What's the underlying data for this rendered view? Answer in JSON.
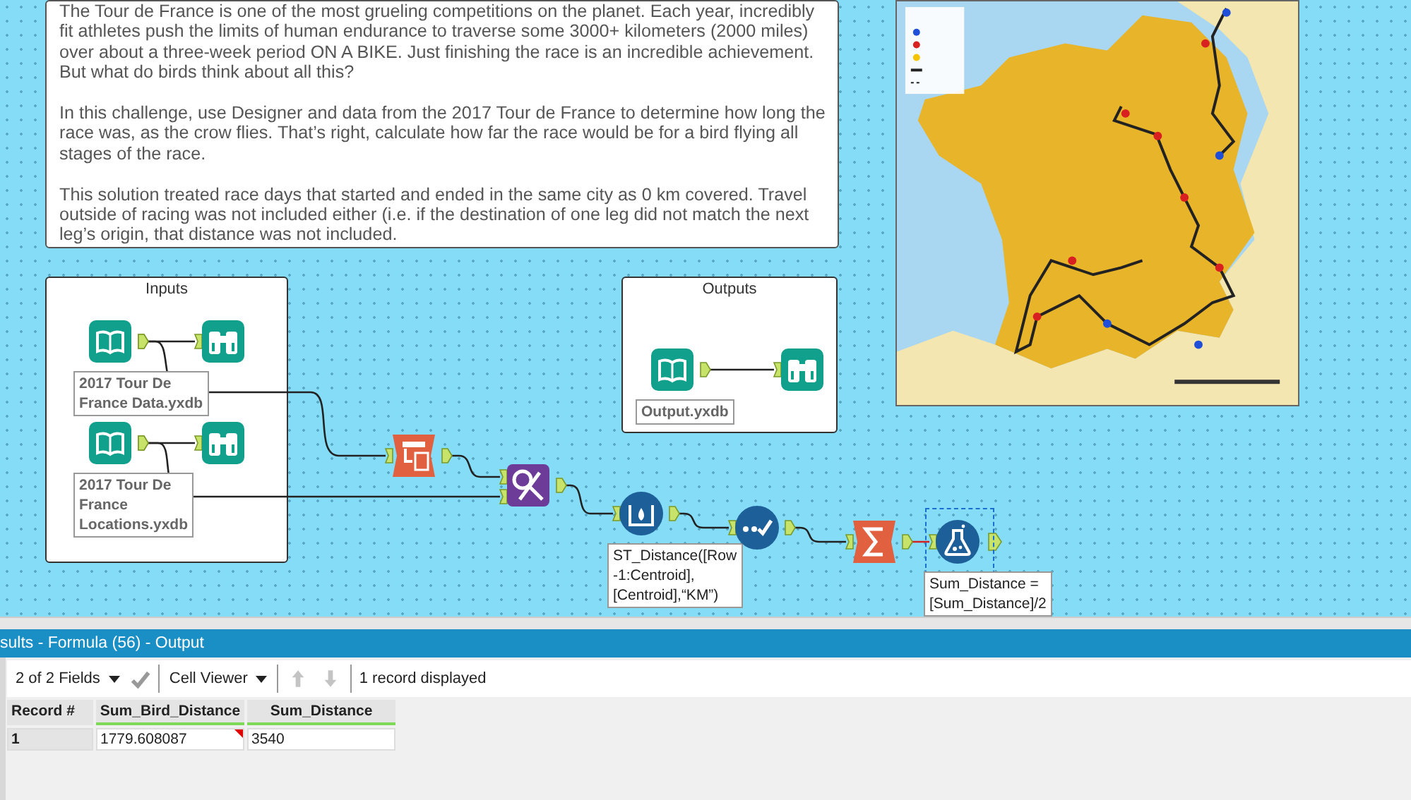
{
  "comment": {
    "paragraphs": [
      "The Tour de France is one of the most grueling competitions on the planet. Each year, incredibly fit athletes push the limits of human endurance to traverse some 3000+ kilometers (2000 miles) over about a three-week period ON A BIKE. Just finishing the race is an incredible achievement. But what do birds think about all this?",
      "In this challenge, use Designer and data from the 2017 Tour de France to determine how long the race was, as the crow flies. That’s right, calculate how far the race would be for a bird flying all stages of the race.",
      "This solution treated race days that started and ended in the same city as 0 km covered. Travel outside of racing was not included either (i.e. if the destination of one leg did not match the next leg’s origin, that distance was not included."
    ]
  },
  "containers": [
    {
      "title": "Inputs"
    },
    {
      "title": "Outputs"
    }
  ],
  "tools": [
    {
      "kind": "input",
      "selected": false,
      "label_lines": [
        "2017 Tour De",
        "France Data.yxdb"
      ]
    },
    {
      "kind": "browse",
      "selected": false
    },
    {
      "kind": "input",
      "selected": false,
      "label_lines": [
        "2017 Tour De",
        "France",
        "Locations.yxdb"
      ]
    },
    {
      "kind": "browse",
      "selected": false
    },
    {
      "kind": "input",
      "selected": false,
      "label_lines": [
        "Output.yxdb"
      ]
    },
    {
      "kind": "browse",
      "selected": false
    },
    {
      "kind": "select",
      "selected": false
    },
    {
      "kind": "join",
      "selected": false
    },
    {
      "kind": "multirow",
      "selected": false,
      "label_lines": [
        "ST_Distance([Row",
        "-1:Centroid],",
        "[Centroid],“KM”)"
      ]
    },
    {
      "kind": "sample",
      "selected": false
    },
    {
      "kind": "summarize",
      "selected": false
    },
    {
      "kind": "formula",
      "selected": true,
      "label_lines": [
        "Sum_Distance =",
        "[Sum_Distance]/2"
      ]
    }
  ],
  "results": {
    "title": "sults - Formula (56) - Output",
    "fields_dropdown": "2 of 2 Fields",
    "viewer_dropdown": "Cell Viewer",
    "nav_buttons": [
      {
        "kind": "up",
        "disabled": true
      },
      {
        "kind": "down",
        "disabled": true
      }
    ],
    "status": "1 record displayed",
    "columns": [
      "Record #",
      "Sum_Bird_Distance",
      "Sum_Distance"
    ],
    "rows": [
      {
        "cells": [
          {
            "text": "1",
            "flagged": false
          },
          {
            "text": "1779.608087",
            "flagged": true
          },
          {
            "text": "3540",
            "flagged": false
          }
        ]
      }
    ]
  }
}
